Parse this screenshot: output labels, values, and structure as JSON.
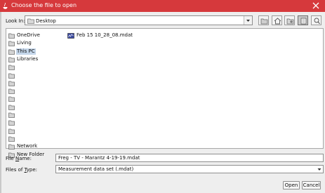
{
  "window": {
    "title": "Choose the file to open"
  },
  "lookin": {
    "label": "Look In:",
    "value": "Desktop"
  },
  "toolbar": [
    "up-one-level-icon",
    "home-icon",
    "new-folder-icon",
    "list-view-icon",
    "details-view-icon"
  ],
  "places": [
    {
      "label": "OneDrive",
      "selected": false
    },
    {
      "label": "Living",
      "selected": false
    },
    {
      "label": "This PC",
      "selected": true
    },
    {
      "label": "Libraries",
      "selected": false
    },
    {
      "label": "",
      "selected": false
    },
    {
      "label": "",
      "selected": false
    },
    {
      "label": "",
      "selected": false
    },
    {
      "label": "",
      "selected": false
    },
    {
      "label": "",
      "selected": false
    },
    {
      "label": "",
      "selected": false
    },
    {
      "label": "",
      "selected": false
    },
    {
      "label": "",
      "selected": false
    },
    {
      "label": "",
      "selected": false
    },
    {
      "label": "",
      "selected": false
    },
    {
      "label": "Network",
      "selected": false
    },
    {
      "label": "New Folder",
      "selected": false
    }
  ],
  "files": [
    {
      "label": "Feb 15 10_28_08.mdat"
    }
  ],
  "filename": {
    "label": "File Name:",
    "value": "Freg - TV - Marantz 4-19-19.mdat"
  },
  "filetype": {
    "label": "Files of Type:",
    "value": "Measurement data set (.mdat)"
  },
  "buttons": {
    "open": "Open",
    "cancel": "Cancel"
  }
}
